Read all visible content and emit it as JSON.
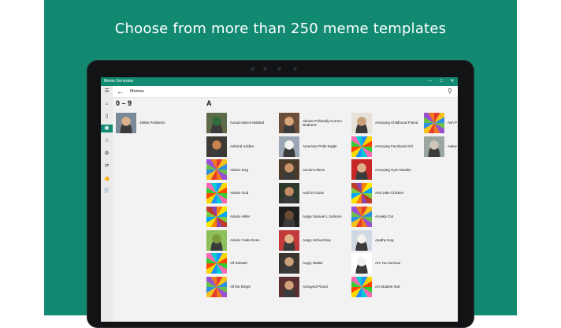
{
  "banner": {
    "headline": "Choose from more than 250 meme templates"
  },
  "window": {
    "title": "Meme Generator",
    "controls": {
      "minimize": "–",
      "maximize": "□",
      "close": "✕"
    }
  },
  "appbar": {
    "back_icon": "arrow-left-icon",
    "back_glyph": "←",
    "title": "Memes",
    "search_icon": "search-icon",
    "search_glyph": "⚲"
  },
  "colors": {
    "accent": "#128a72",
    "rail_bg": "#eaeaea",
    "content_bg": "#f2f2f2"
  },
  "nav_rail": [
    {
      "icon": "hamburger-icon",
      "glyph": "☰",
      "active": false
    },
    {
      "icon": "home-icon",
      "glyph": "⌂",
      "active": false
    },
    {
      "icon": "bookmark-icon",
      "glyph": "▯",
      "active": false
    },
    {
      "icon": "image-icon",
      "glyph": "▣",
      "active": true
    },
    {
      "icon": "star-icon",
      "glyph": "☆",
      "active": false
    },
    {
      "icon": "gear-icon",
      "glyph": "⚙",
      "active": false
    },
    {
      "icon": "transfer-icon",
      "glyph": "⇄",
      "active": false
    },
    {
      "icon": "thumbs-up-icon",
      "glyph": "👍",
      "active": false
    },
    {
      "icon": "cart-icon",
      "glyph": "🛒",
      "active": false
    }
  ],
  "sections": [
    {
      "heading": "0 – 9"
    },
    {
      "heading": "A"
    }
  ],
  "memes": {
    "numeric": [
      "1990s Problems"
    ],
    "col1": [
      "Actual Advice Mallard",
      "Admiral Ackbar",
      "Advice Dog",
      "Advice God",
      "Advice Hitler",
      "Advice Yoda Gives",
      "Alf Stewart",
      "All the things"
    ],
    "col2": [
      "Almost Politically Correct Redneck",
      "American Pride Eagle",
      "Ancient Aliens",
      "And It's Gone",
      "Angry Samuel L Jackson",
      "Angry School Boy",
      "Angry Walter",
      "Annoyed Picard"
    ],
    "col3": [
      "Annoying Childhood Friend",
      "Annoying Facebook Girl",
      "Annoying Gym Newbie",
      "Anti-Joke Chicken",
      "Anxiety Cat",
      "Apathy Dog",
      "Are You Serious",
      "Art Student Owl"
    ],
    "col4": [
      "Ash P",
      "Awkw"
    ]
  }
}
